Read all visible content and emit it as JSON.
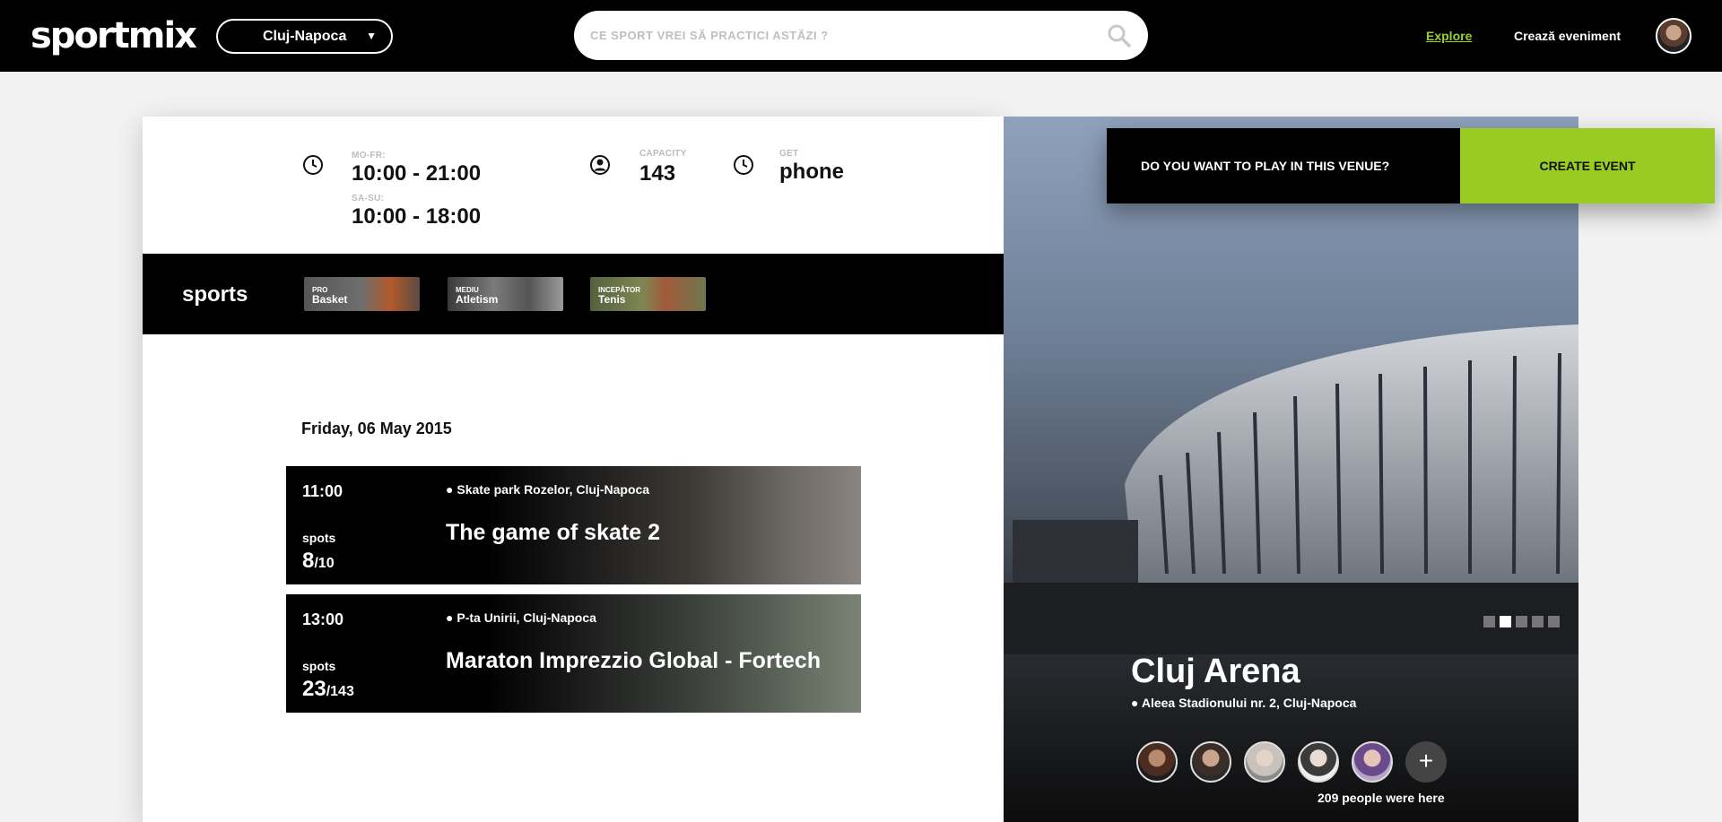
{
  "header": {
    "logo_text": "sportmix",
    "city": "Cluj-Napoca",
    "search_placeholder": "CE SPORT VREI SĂ PRACTICI ASTĂZI ?",
    "nav": {
      "explore": "Explore",
      "create_event": "Crează eveniment"
    },
    "accent_color": "#9bd123"
  },
  "venue_info": {
    "hours": [
      {
        "label": "MO-FR:",
        "value": "10:00 - 21:00"
      },
      {
        "label": "SA-SU:",
        "value": "10:00 - 18:00"
      }
    ],
    "capacity_label": "CAPACITY",
    "capacity_value": "143",
    "get_label": "GET",
    "get_value": "phone"
  },
  "sports": {
    "title": "sports",
    "items": [
      {
        "level": "PRO",
        "name": "Basket"
      },
      {
        "level": "MEDIU",
        "name": "Atletism"
      },
      {
        "level": "INCEPĂTOR",
        "name": "Tenis"
      }
    ]
  },
  "events": {
    "date": "Friday, 06 May 2015",
    "items": [
      {
        "time": "11:00",
        "location": "Skate park Rozelor, Cluj-Napoca",
        "title": "The game of skate 2",
        "spots_label": "spots",
        "spots_taken": "8",
        "spots_total": "/10"
      },
      {
        "time": "13:00",
        "location": "P-ta Unirii, Cluj-Napoca",
        "title": "Maraton Imprezzio Global - Fortech",
        "spots_label": "spots",
        "spots_taken": "23",
        "spots_total": "/143"
      }
    ]
  },
  "venue": {
    "name": "Cluj Arena",
    "address": "Aleea Stadionului nr. 2, Cluj-Napoca",
    "visitors_text": "209 people were here",
    "more_symbol": "+",
    "slider_active_index": 2,
    "slider_count": 5
  },
  "cta": {
    "question": "DO YOU WANT TO PLAY IN THIS VENUE?",
    "button": "CREATE EVENT",
    "button_color": "#99cc22"
  }
}
